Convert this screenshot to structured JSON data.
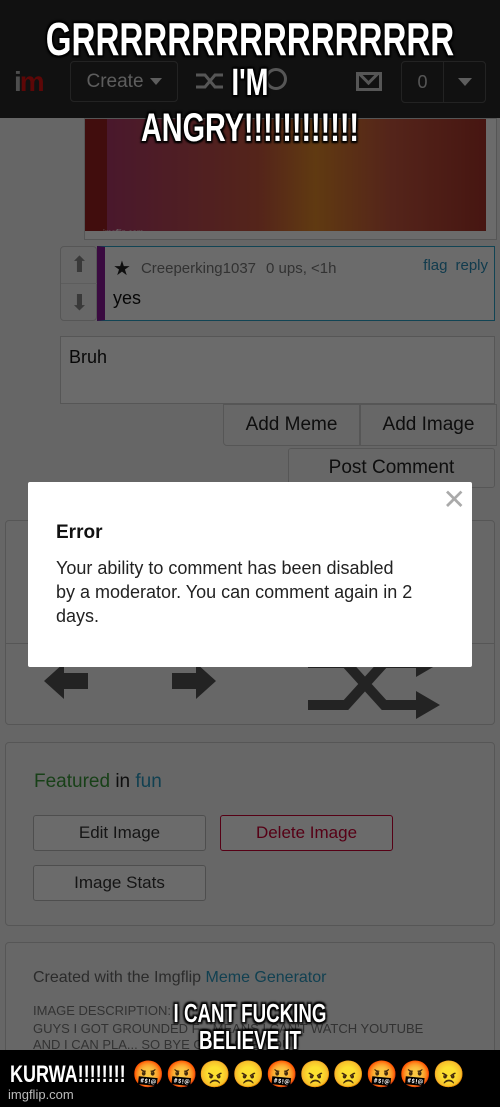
{
  "header": {
    "logo_i": "i",
    "logo_m": "m",
    "create_label": "Create",
    "notification_count": "0"
  },
  "meme_watermark_small": "imgflip.com",
  "comment": {
    "username": "Creeperking1037",
    "meta": "0 ups, <1h",
    "flag_label": "flag",
    "reply_label": "reply",
    "text": "yes",
    "star": "★",
    "up_arrow": "⬆",
    "down_arrow": "⬇"
  },
  "comment_input": {
    "value": "Bruh"
  },
  "buttons": {
    "add_meme": "Add Meme",
    "add_image": "Add Image",
    "post_comment": "Post Comment"
  },
  "modal": {
    "close": "✕",
    "title": "Error",
    "message": "Your ability to comment has been disabled by a moderator. You can comment again in 2 days."
  },
  "featured": {
    "featured_word": "Featured",
    "in_word": " in ",
    "stream": "fun",
    "edit_image": "Edit Image",
    "delete_image": "Delete Image",
    "image_stats": "Image Stats"
  },
  "description": {
    "created_prefix": "Created with the Imgflip ",
    "created_link": "Meme Generator",
    "label": "IMAGE DESCRIPTION:",
    "text": "GUYS I GOT GROUNDED F... MEANS I CAN'T WATCH YOUTUBE AND I CAN PLA... SO BYE GUYS SEE YOU"
  },
  "captions": {
    "top_line1": "GRRRRRRRRRRRRRRRR",
    "top_line2": "I'M",
    "top_line3": "ANGRY!!!!!!!!!!!!",
    "mid_line1": "I CANT FUCKING",
    "mid_line2": "BELIEVE IT",
    "bottom_word": "KURWA!!!!!!!!",
    "bottom_emojis": "🤬🤬😠😠🤬😠😠🤬🤬😠"
  },
  "watermark": "imgflip.com"
}
